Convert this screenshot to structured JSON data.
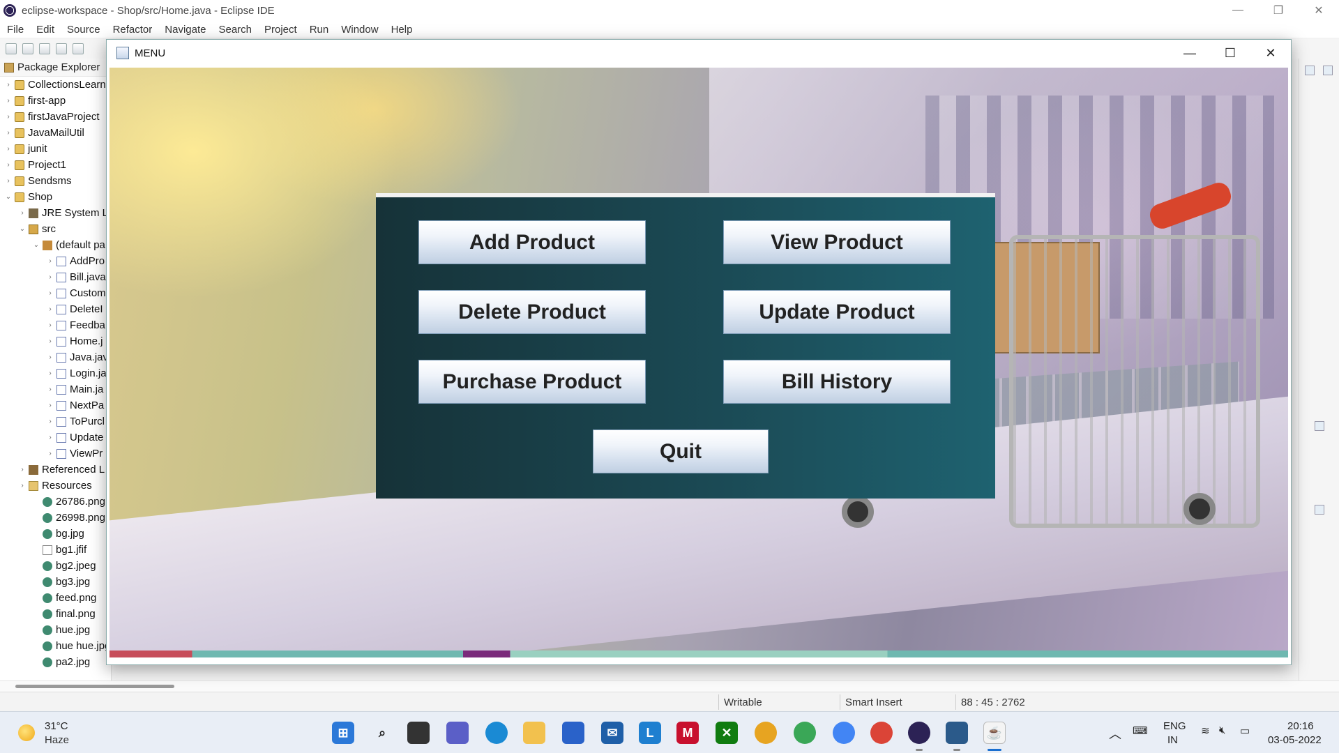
{
  "ide": {
    "title": "eclipse-workspace - Shop/src/Home.java - Eclipse IDE",
    "menu": [
      "File",
      "Edit",
      "Source",
      "Refactor",
      "Navigate",
      "Search",
      "Project",
      "Run",
      "Window",
      "Help"
    ],
    "package_explorer": {
      "title": "Package Explorer",
      "items": [
        {
          "label": "CollectionsLearn",
          "icon": "project-icon",
          "twisty": "›",
          "indent": 0
        },
        {
          "label": "first-app",
          "icon": "project-icon",
          "twisty": "›",
          "indent": 0
        },
        {
          "label": "firstJavaProject",
          "icon": "project-icon",
          "twisty": "›",
          "indent": 0
        },
        {
          "label": "JavaMailUtil",
          "icon": "project-icon",
          "twisty": "›",
          "indent": 0
        },
        {
          "label": "junit",
          "icon": "project-icon",
          "twisty": "›",
          "indent": 0
        },
        {
          "label": "Project1",
          "icon": "project-icon",
          "twisty": "›",
          "indent": 0
        },
        {
          "label": "Sendsms",
          "icon": "project-icon",
          "twisty": "›",
          "indent": 0
        },
        {
          "label": "Shop",
          "icon": "project-icon",
          "twisty": "⌄",
          "indent": 0
        },
        {
          "label": "JRE System Li",
          "icon": "library-icon",
          "twisty": "›",
          "indent": 1
        },
        {
          "label": "src",
          "icon": "source-folder-icon",
          "twisty": "⌄",
          "indent": 1
        },
        {
          "label": "(default pa",
          "icon": "package-icon",
          "twisty": "⌄",
          "indent": 2
        },
        {
          "label": "AddPro",
          "icon": "java-file-icon",
          "twisty": "›",
          "indent": 3
        },
        {
          "label": "Bill.java",
          "icon": "java-file-icon",
          "twisty": "›",
          "indent": 3
        },
        {
          "label": "Custom",
          "icon": "java-file-icon",
          "twisty": "›",
          "indent": 3
        },
        {
          "label": "DeleteI",
          "icon": "java-file-icon",
          "twisty": "›",
          "indent": 3
        },
        {
          "label": "Feedba",
          "icon": "java-file-icon",
          "twisty": "›",
          "indent": 3
        },
        {
          "label": "Home.j",
          "icon": "java-file-icon",
          "twisty": "›",
          "indent": 3
        },
        {
          "label": "Java.jav",
          "icon": "java-file-icon",
          "twisty": "›",
          "indent": 3
        },
        {
          "label": "Login.ja",
          "icon": "java-file-icon",
          "twisty": "›",
          "indent": 3
        },
        {
          "label": "Main.ja",
          "icon": "java-file-icon",
          "twisty": "›",
          "indent": 3
        },
        {
          "label": "NextPa",
          "icon": "java-file-icon",
          "twisty": "›",
          "indent": 3
        },
        {
          "label": "ToPurcl",
          "icon": "java-file-icon",
          "twisty": "›",
          "indent": 3
        },
        {
          "label": "Update",
          "icon": "java-file-icon",
          "twisty": "›",
          "indent": 3
        },
        {
          "label": "ViewPr",
          "icon": "java-file-icon",
          "twisty": "›",
          "indent": 3
        },
        {
          "label": "Referenced L",
          "icon": "referenced-libraries-icon",
          "twisty": "›",
          "indent": 1
        },
        {
          "label": "Resources",
          "icon": "folder-icon",
          "twisty": "›",
          "indent": 1
        },
        {
          "label": "26786.png",
          "icon": "image-file-icon",
          "twisty": "",
          "indent": 2
        },
        {
          "label": "26998.png",
          "icon": "image-file-icon",
          "twisty": "",
          "indent": 2
        },
        {
          "label": "bg.jpg",
          "icon": "image-file-icon",
          "twisty": "",
          "indent": 2
        },
        {
          "label": "bg1.jfif",
          "icon": "file-icon",
          "twisty": "",
          "indent": 2
        },
        {
          "label": "bg2.jpeg",
          "icon": "image-file-icon",
          "twisty": "",
          "indent": 2
        },
        {
          "label": "bg3.jpg",
          "icon": "image-file-icon",
          "twisty": "",
          "indent": 2
        },
        {
          "label": "feed.png",
          "icon": "image-file-icon",
          "twisty": "",
          "indent": 2
        },
        {
          "label": "final.png",
          "icon": "image-file-icon",
          "twisty": "",
          "indent": 2
        },
        {
          "label": "hue.jpg",
          "icon": "image-file-icon",
          "twisty": "",
          "indent": 2
        },
        {
          "label": "hue hue.jpg",
          "icon": "image-file-icon",
          "twisty": "",
          "indent": 2
        },
        {
          "label": "pa2.jpg",
          "icon": "image-file-icon",
          "twisty": "",
          "indent": 2
        }
      ]
    },
    "status": {
      "writable": "Writable",
      "insert_mode": "Smart Insert",
      "position": "88 : 45 : 2762"
    }
  },
  "menu_window": {
    "title": "MENU",
    "buttons": {
      "add": "Add Product",
      "view": "View Product",
      "delete": "Delete Product",
      "update": "Update Product",
      "purchase": "Purchase Product",
      "bill_history": "Bill History",
      "quit": "Quit"
    }
  },
  "taskbar": {
    "weather": {
      "temp": "31°C",
      "desc": "Haze"
    },
    "language": {
      "line1": "ENG",
      "line2": "IN"
    },
    "clock": {
      "time": "20:16",
      "date": "03-05-2022"
    }
  },
  "colors": {
    "panel_left": "#163238",
    "panel_right": "#1e6270",
    "button_top": "#ffffff",
    "button_bottom": "#c0cfe2",
    "taskbar_bg": "#e9eef6"
  }
}
